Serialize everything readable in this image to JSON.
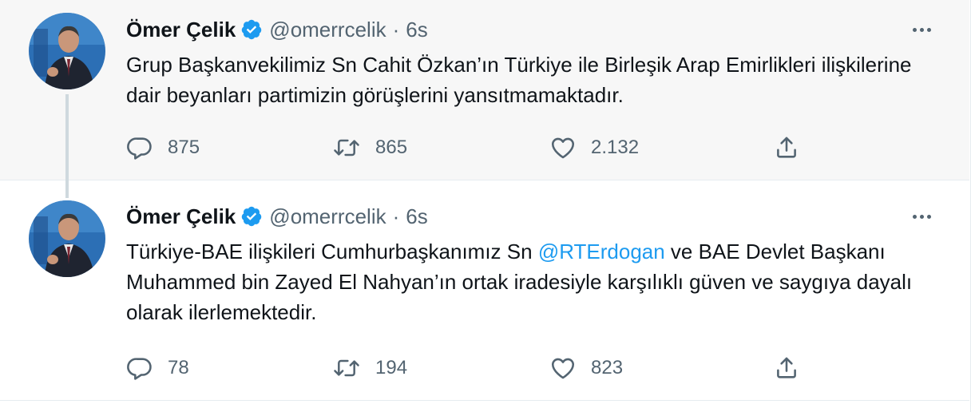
{
  "colors": {
    "accent": "#1d9bf0",
    "secondary_text": "#536471",
    "primary_text": "#0f1419",
    "highlight_bg": "#f7f7f7",
    "thread_line": "#cfd9de"
  },
  "tweets": [
    {
      "author_name": "Ömer Çelik",
      "handle": "@omerrcelik",
      "separator": "·",
      "time": "6s",
      "verified_icon": "verified-badge-icon",
      "more_icon": "more-dots-icon",
      "text_parts": {
        "before": "Grup Başkanvekilimiz Sn Cahit Özkan’ın Türkiye ile Birleşik Arap Emirlikleri ilişkilerine dair beyanları partimizin görüşlerini yansıtmamaktadır.",
        "mention": "",
        "after": ""
      },
      "stats": {
        "replies": "875",
        "retweets": "865",
        "likes": "2.132"
      }
    },
    {
      "author_name": "Ömer Çelik",
      "handle": "@omerrcelik",
      "separator": "·",
      "time": "6s",
      "verified_icon": "verified-badge-icon",
      "more_icon": "more-dots-icon",
      "text_parts": {
        "before": "Türkiye-BAE ilişkileri Cumhurbaşkanımız Sn ",
        "mention": "@RTErdogan",
        "after": " ve BAE Devlet Başkanı Muhammed bin Zayed El Nahyan’ın ortak iradesiyle karşılıklı güven ve saygıya dayalı olarak ilerlemektedir."
      },
      "stats": {
        "replies": "78",
        "retweets": "194",
        "likes": "823"
      }
    }
  ],
  "icons": {
    "reply": "reply-icon",
    "retweet": "retweet-icon",
    "like": "heart-icon",
    "share": "share-icon"
  }
}
